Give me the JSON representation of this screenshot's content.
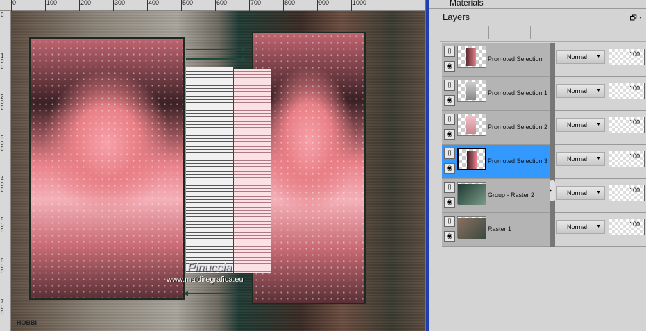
{
  "ruler": {
    "h_labels": [
      "0",
      "100",
      "200",
      "300",
      "400",
      "500",
      "600",
      "700",
      "800",
      "900",
      "1000"
    ],
    "v_labels": [
      "0",
      "100",
      "200",
      "300",
      "400",
      "500",
      "600",
      "700"
    ]
  },
  "canvas": {
    "watermark_name": "Pinuccia",
    "watermark_url": "www.maidiregrafica.eu",
    "signature": "HOBBI"
  },
  "panel": {
    "materials_title": "Materials",
    "title": "Layers",
    "float_icon": "restore-icon",
    "menu_icon": "▾"
  },
  "layers": [
    {
      "name": "Promoted Selection",
      "blend": "Normal",
      "opacity": "100",
      "selected": false
    },
    {
      "name": "Promoted Selection 1",
      "blend": "Normal",
      "opacity": "100",
      "selected": false
    },
    {
      "name": "Promoted Selection 2",
      "blend": "Normal",
      "opacity": "100",
      "selected": false
    },
    {
      "name": "Promoted Selection 3",
      "blend": "Normal",
      "opacity": "100",
      "selected": true
    },
    {
      "name": "Group - Raster 2",
      "blend": "Normal",
      "opacity": "100",
      "selected": false
    },
    {
      "name": "Raster 1",
      "blend": "Normal",
      "opacity": "100",
      "selected": false
    }
  ],
  "colors": {
    "selection": "#3399ff",
    "divider": "#1f3fb0"
  }
}
